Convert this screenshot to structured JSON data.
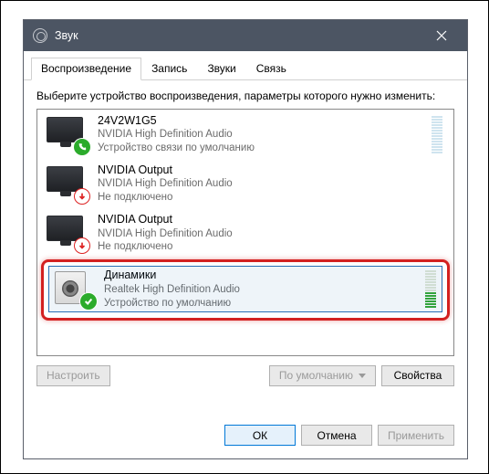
{
  "window": {
    "title": "Звук",
    "tabs": [
      {
        "id": "playback",
        "label": "Воспроизведение",
        "active": true
      },
      {
        "id": "recording",
        "label": "Запись",
        "active": false
      },
      {
        "id": "sounds",
        "label": "Звуки",
        "active": false
      },
      {
        "id": "comms",
        "label": "Связь",
        "active": false
      }
    ],
    "instruction": "Выберите устройство воспроизведения, параметры которого нужно изменить:"
  },
  "devices": [
    {
      "kind": "monitor",
      "name": "24V2W1G5",
      "provider": "NVIDIA High Definition Audio",
      "status": "Устройство связи по умолчанию",
      "badge": "phone-green",
      "meter": {
        "bars": 14,
        "on": 0,
        "style": "high"
      }
    },
    {
      "kind": "monitor",
      "name": "NVIDIA Output",
      "provider": "NVIDIA High Definition Audio",
      "status": "Не подключено",
      "badge": "down-red",
      "meter": null
    },
    {
      "kind": "monitor",
      "name": "NVIDIA Output",
      "provider": "NVIDIA High Definition Audio",
      "status": "Не подключено",
      "badge": "down-red",
      "meter": null
    },
    {
      "kind": "speaker",
      "name": "Динамики",
      "provider": "Realtek High Definition Audio",
      "status": "Устройство по умолчанию",
      "badge": "check-green",
      "selected": true,
      "highlighted": true,
      "meter": {
        "bars": 14,
        "on": 6,
        "style": "mid"
      }
    }
  ],
  "buttons": {
    "configure": "Настроить",
    "setdefault": "По умолчанию",
    "properties": "Свойства",
    "ok": "ОК",
    "cancel": "Отмена",
    "apply": "Применить"
  },
  "colors": {
    "titlebar": "#4c5563",
    "highlight_border": "#d32121",
    "primary_border": "#0078d7"
  }
}
